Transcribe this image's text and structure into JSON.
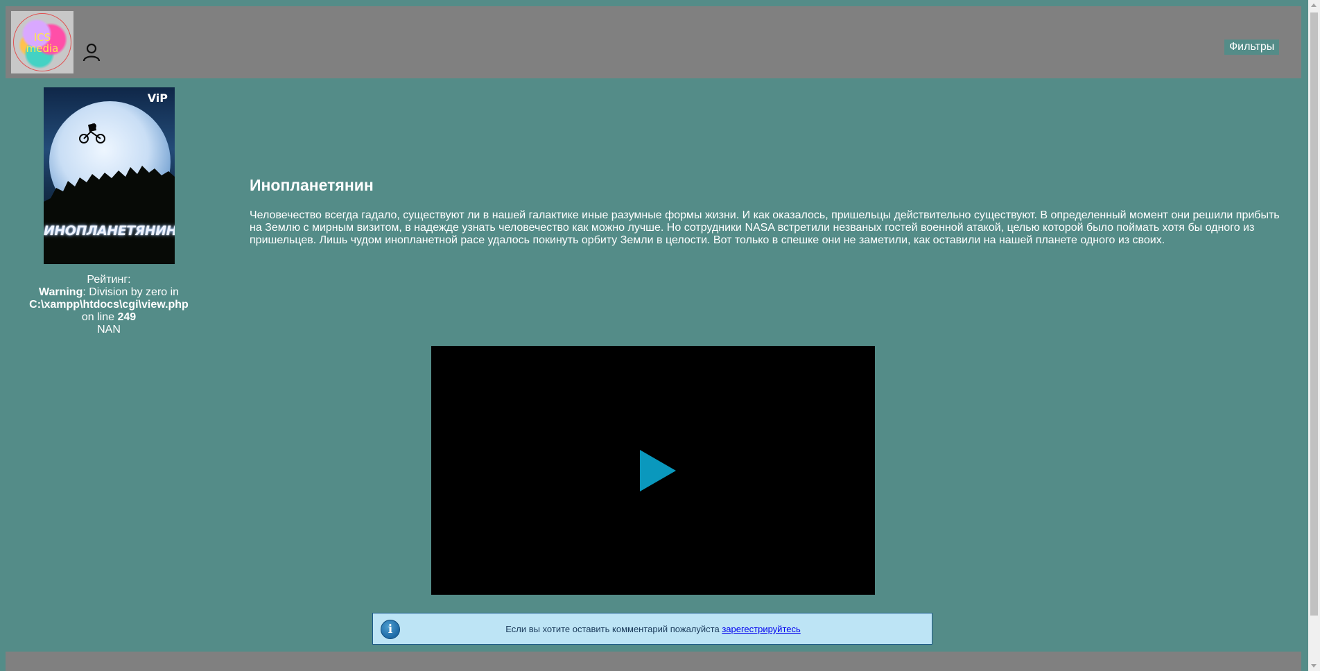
{
  "header": {
    "logo_text_line1": "ICS",
    "logo_text_line2": "media",
    "user_icon": "user-icon",
    "filters_label": "Фильтры"
  },
  "poster": {
    "badge": "ViP",
    "title": "ИНОПЛАНЕТЯНИН"
  },
  "rating": {
    "label": "Рейтинг:",
    "warning_label": "Warning",
    "warning_text": ": Division by zero in",
    "path": "C:\\xampp\\htdocs\\cgi\\view.php",
    "on_line": "on line",
    "line_number": "249",
    "value": "NAN"
  },
  "movie": {
    "title": "Инопланетянин",
    "description": "Человечество всегда гадало, существуют ли в нашей галактике иные разумные формы жизни. И как оказалось, пришельцы действительно существуют. В определенный момент они решили прибыть на Землю с мирным визитом, в надежде узнать человечество как можно лучше. Но сотрудники NASA встретили незваных гостей военной атакой, целью которой было поймать хотя бы одного из пришельцев. Лишь чудом инопланетной расе удалось покинуть орбиту Земли в целости. Вот только в спешке они не заметили, как оставили на нашей планете одного из своих."
  },
  "video": {
    "play_icon": "play-icon"
  },
  "notice": {
    "info_icon": "info-icon",
    "info_glyph": "i",
    "text": "Если вы хотите оставить комментарий пожалуйста ",
    "link_text": "зарегестрируйтесь"
  },
  "colors": {
    "page_background": "#548c88",
    "header_background": "#808080",
    "play_button": "#0a98bd",
    "notice_background": "#bde4f5"
  }
}
